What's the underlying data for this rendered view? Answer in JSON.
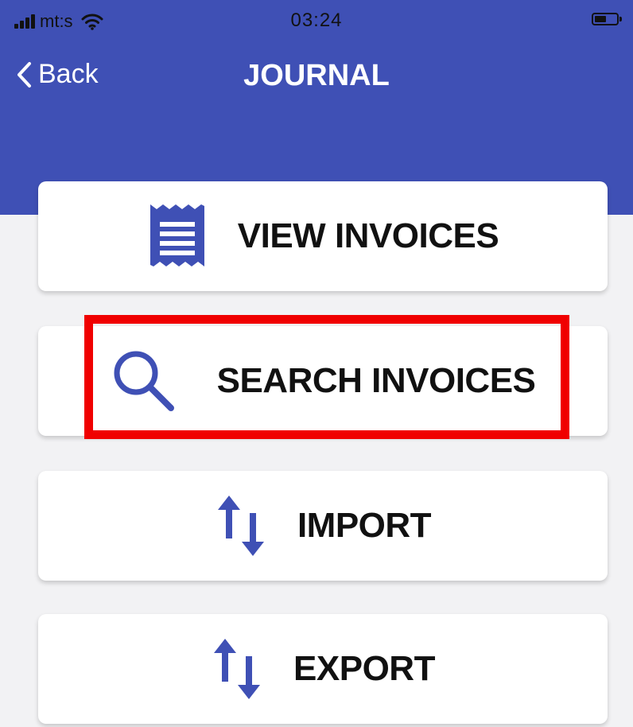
{
  "status_bar": {
    "carrier": "mt:s",
    "time": "03:24"
  },
  "nav": {
    "back_label": "Back",
    "title": "JOURNAL"
  },
  "menu": {
    "items": [
      {
        "label": "VIEW INVOICES",
        "icon": "receipt-icon"
      },
      {
        "label": "SEARCH INVOICES",
        "icon": "search-icon"
      },
      {
        "label": "IMPORT",
        "icon": "swap-arrows-icon"
      },
      {
        "label": "EXPORT",
        "icon": "swap-arrows-icon"
      }
    ]
  },
  "colors": {
    "header": "#3f50b5",
    "icon": "#3f50b5",
    "highlight": "#f00000",
    "card": "#ffffff"
  }
}
